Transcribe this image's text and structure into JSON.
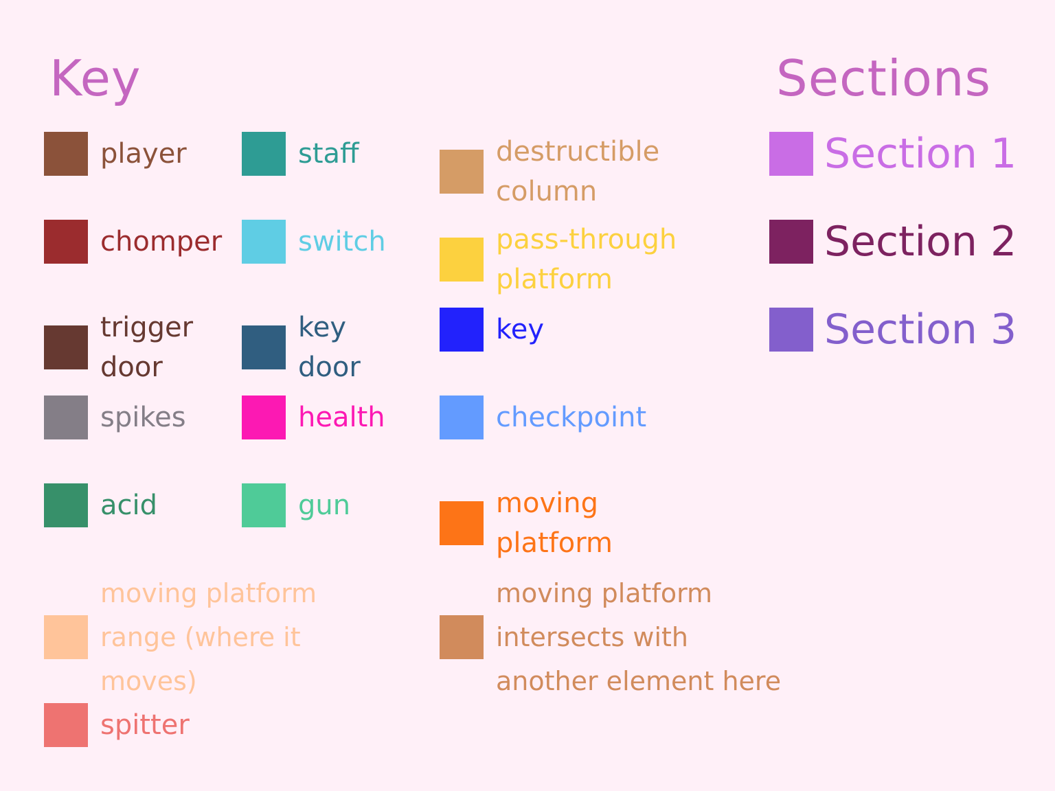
{
  "key": {
    "title": "Key",
    "title_color": "#c466c0",
    "items": [
      {
        "label": "player",
        "color": "#8b523a"
      },
      {
        "label": "staff",
        "color": "#2e9c94"
      },
      {
        "label": "destructible\ncolumn",
        "color": "#d59c66"
      },
      {
        "label": "chomper",
        "color": "#9b2c2e"
      },
      {
        "label": "switch",
        "color": "#5fcde4"
      },
      {
        "label": "pass-through\nplatform",
        "color": "#fcd13f"
      },
      {
        "label": "trigger\ndoor",
        "color": "#663931"
      },
      {
        "label": "key\ndoor",
        "color": "#305e80"
      },
      {
        "label": "key",
        "color": "#2222fc"
      },
      {
        "label": "spikes",
        "color": "#847e87"
      },
      {
        "label": "health",
        "color": "#fc19b3"
      },
      {
        "label": "checkpoint",
        "color": "#639bff"
      },
      {
        "label": "acid",
        "color": "#37906a"
      },
      {
        "label": "gun",
        "color": "#4fcb98"
      },
      {
        "label": "moving\nplatform",
        "color": "#fd7417"
      },
      {
        "label": "moving platform\nrange (where it\nmoves)",
        "color": "#ffc49a"
      },
      {
        "label": "moving platform\nintersects with\nanother element here",
        "color": "#d18b5c"
      },
      {
        "label": "spitter",
        "color": "#ee7371"
      }
    ]
  },
  "sections": {
    "title": "Sections",
    "title_color": "#c466c0",
    "items": [
      {
        "label": "Section 1",
        "color": "#c96de5"
      },
      {
        "label": "Section 2",
        "color": "#7d2260"
      },
      {
        "label": "Section 3",
        "color": "#835fcc"
      }
    ]
  }
}
